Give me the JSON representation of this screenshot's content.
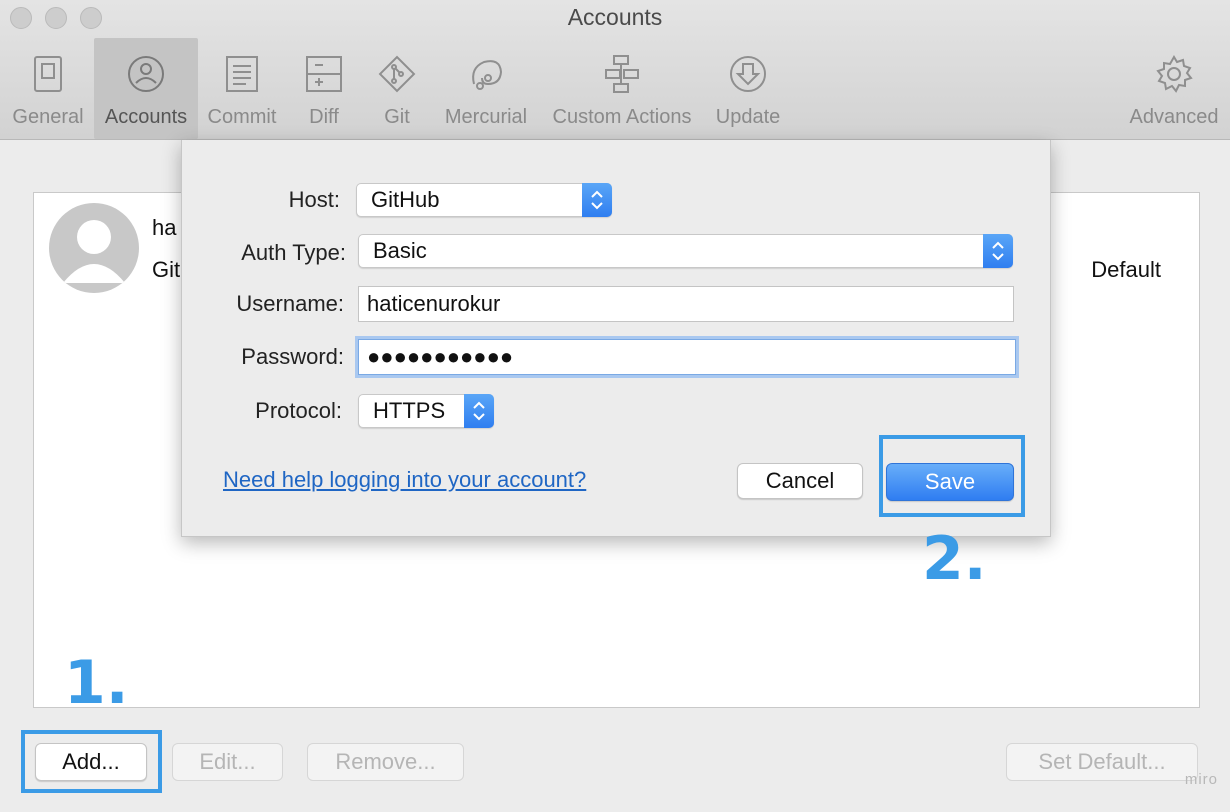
{
  "window": {
    "title": "Accounts"
  },
  "toolbar": {
    "items": [
      {
        "label": "General",
        "icon": "switch-icon"
      },
      {
        "label": "Accounts",
        "icon": "user-icon",
        "active": true
      },
      {
        "label": "Commit",
        "icon": "document-icon"
      },
      {
        "label": "Diff",
        "icon": "diff-icon"
      },
      {
        "label": "Git",
        "icon": "git-icon"
      },
      {
        "label": "Mercurial",
        "icon": "mercurial-icon"
      },
      {
        "label": "Custom Actions",
        "icon": "actions-icon"
      },
      {
        "label": "Update",
        "icon": "download-icon"
      },
      {
        "label": "Advanced",
        "icon": "gear-icon"
      }
    ]
  },
  "account_list": {
    "rows": [
      {
        "name": "ha",
        "host": "Git",
        "badge": "Default"
      }
    ]
  },
  "dialog": {
    "host_label": "Host:",
    "host_value": "GitHub",
    "auth_label": "Auth Type:",
    "auth_value": "Basic",
    "username_label": "Username:",
    "username_value": "haticenurokur",
    "password_label": "Password:",
    "password_value": "●●●●●●●●●●●",
    "protocol_label": "Protocol:",
    "protocol_value": "HTTPS",
    "help_link": "Need help logging into your account?",
    "cancel_label": "Cancel",
    "save_label": "Save"
  },
  "buttons": {
    "add": "Add...",
    "edit": "Edit...",
    "remove": "Remove...",
    "set_default": "Set Default..."
  },
  "annotations": {
    "step1": "1.",
    "step2": "2.",
    "highlight_color": "#3b9be6"
  },
  "watermark": "miro"
}
